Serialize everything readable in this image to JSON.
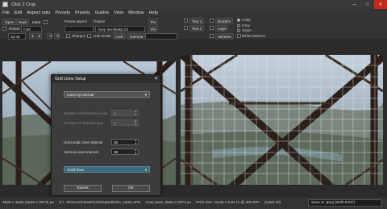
{
  "window": {
    "title": "Click 2 Crop",
    "minimize": "─",
    "maximize": "□",
    "close": "✕"
  },
  "menu": [
    "File",
    "Edit",
    "Aspect ratio",
    "Presets",
    "Presets",
    "Guides",
    "View",
    "Window",
    "Help"
  ],
  "toolbar": {
    "open": "Open",
    "save": "Save",
    "input_label": "Input",
    "output_label": "Output",
    "rotate_label": "Rotate",
    "rotate_value": "0,60",
    "preset_aspect": "Preset aspect",
    "ratio_value": "32:45",
    "font_value": "Yuny Semibsky 13",
    "px1": "Pix",
    "px2": "Pix",
    "sharpen": "Sharpen",
    "auto_levels": "Auto levels",
    "lock": "Lock",
    "gamma": "Gamma",
    "text1": "Text 1",
    "text2": "Text 2",
    "borders": "Borders",
    "logo": "Logo",
    "variants": "Variants",
    "color_opts": [
      "Color",
      "Grey",
      "Sepia",
      "White balance"
    ]
  },
  "dialog": {
    "title": "Grid Lines Setup",
    "close": "✕",
    "mode": "Lines by interval",
    "num_horizontal_label": "Number of Horizontal Lines",
    "num_vertical_label": "Number of Vertical Lines",
    "num_horizontal_value": "3",
    "num_vertical_value": "3",
    "horiz_interval_label": "Horizontal Lines Interval",
    "vert_interval_label": "Vertical Lines Interval",
    "horiz_interval_value": "36",
    "vert_interval_value": "36",
    "line_style": "Solid lines",
    "revert": "Revert",
    "ok": "OK"
  },
  "status": {
    "dims": "4920 x 3264 (4929 x 2973) px",
    "path": "C:\\...\\Pictures\\TestPics\\Rotated\\DSC_0225.JPG",
    "crop_area": "Crop area: 4929 x 2973 px",
    "print_size": "Print size: 16,09 x 9,91 in @ 300 DPI",
    "disk": "(1303 mi)",
    "save_as": "Save to Jpeg (With EXIF)"
  },
  "colors": {
    "accent_select": "#3d6b7a",
    "close_red": "#c42b1c"
  }
}
